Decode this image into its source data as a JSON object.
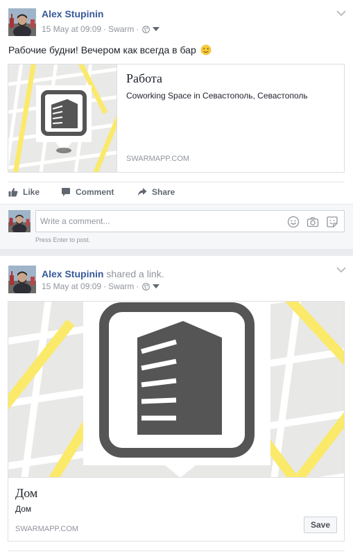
{
  "colors": {
    "link": "#365899",
    "meta": "#90949c",
    "map_road": "#fbe96a",
    "map_bg": "#e8e8e8"
  },
  "post1": {
    "author": "Alex Stupinin",
    "timestamp": "15 May at 09:09",
    "source": "Swarm",
    "text": "Рабочие будни! Вечером как всегда в бар",
    "attachment": {
      "title": "Работа",
      "description": "Coworking Space in Севастополь, Севастополь",
      "domain": "SWARMAPP.COM"
    },
    "actions": {
      "like": "Like",
      "comment": "Comment",
      "share": "Share"
    },
    "comment_placeholder": "Write a comment...",
    "comment_hint": "Press Enter to post."
  },
  "post2": {
    "author": "Alex Stupinin",
    "shared_text": "shared a link.",
    "timestamp": "15 May at 09:09",
    "source": "Swarm",
    "attachment": {
      "title": "Дом",
      "description": "Дом",
      "domain": "SWARMAPP.COM",
      "save_label": "Save"
    }
  }
}
